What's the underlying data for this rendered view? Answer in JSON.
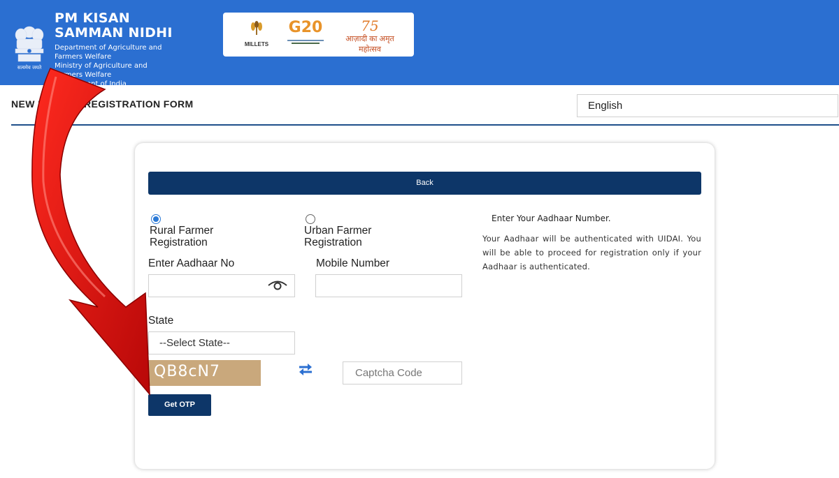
{
  "header": {
    "title_line1": "PM KISAN",
    "title_line2": "SAMMAN NIDHI",
    "sub_lines": [
      "Department of Agriculture and",
      "Farmers Welfare",
      "Ministry of Agriculture and",
      "Farmers Welfare",
      "Government of India"
    ],
    "emblem_caption": "सत्यमेव जयते",
    "logos": {
      "millets": "MILLETS",
      "g20": "G20",
      "azadi_number": "75",
      "azadi_text": "आज़ादी का अमृत महोत्सव"
    }
  },
  "page": {
    "title": "NEW FARMER REGISTRATION FORM",
    "language": "English"
  },
  "form": {
    "back_label": "Back",
    "radio_rural": [
      "Rural Farmer",
      "Registration"
    ],
    "radio_urban": [
      "Urban Farmer",
      "Registration"
    ],
    "aadhaar_label": "Enter Aadhaar No",
    "aadhaar_value": "",
    "mobile_label": "Mobile Number",
    "mobile_value": "",
    "state_label": "State",
    "state_selected": "--Select State--",
    "captcha_text": "QB8cN7",
    "captcha_placeholder": "Captcha Code",
    "otp_label": "Get OTP"
  },
  "info": {
    "heading": "Enter Your Aadhaar Number.",
    "body": "Your Aadhaar will be authenticated with UIDAI. You will be able to proceed for registration only if your Aadhaar is authenticated."
  },
  "colors": {
    "header_bg": "#2b6fd1",
    "button_bg": "#0d3668",
    "captcha_bg": "#c9a87c",
    "arrow": "#e01414",
    "radio_accent": "#2b79d6"
  }
}
